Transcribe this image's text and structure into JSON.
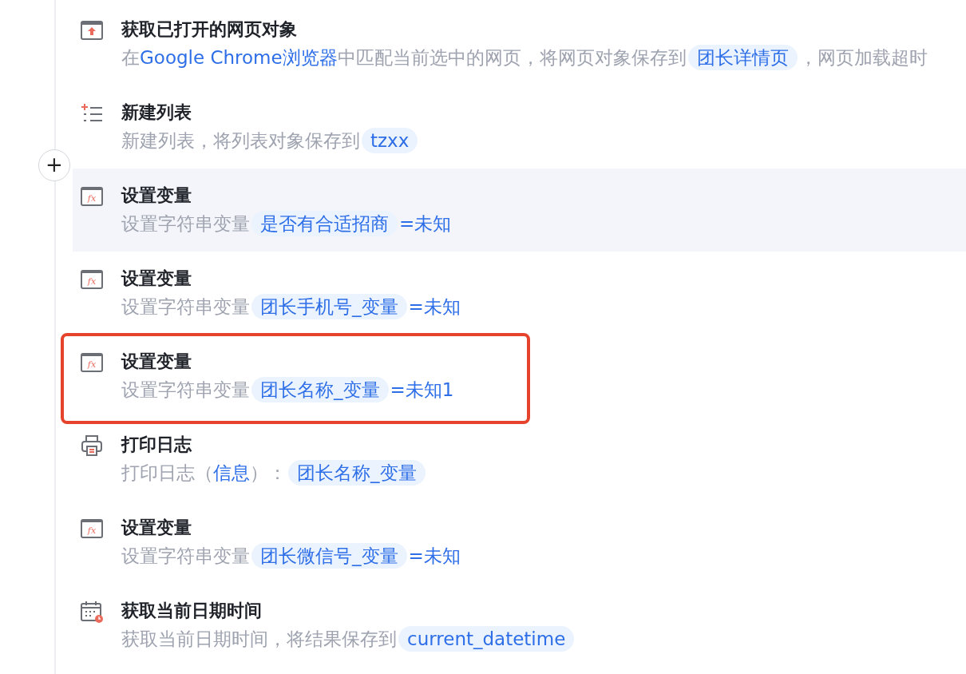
{
  "insert_button": {
    "symbol": "+"
  },
  "steps": [
    {
      "kind": "web",
      "title": "获取已打开的网页对象",
      "hovered": false,
      "outlined": false,
      "description": [
        {
          "kind": "text",
          "text": "在"
        },
        {
          "kind": "link",
          "text": "Google Chrome浏览器"
        },
        {
          "kind": "text",
          "text": "中匹配当前选中的网页，将网页对象保存到"
        },
        {
          "kind": "var",
          "text": "团长详情页"
        },
        {
          "kind": "text",
          "text": "，网页加载超时"
        }
      ]
    },
    {
      "kind": "list",
      "title": "新建列表",
      "hovered": false,
      "outlined": false,
      "description": [
        {
          "kind": "text",
          "text": "新建列表，将列表对象保存到"
        },
        {
          "kind": "var",
          "text": "tzxx"
        }
      ]
    },
    {
      "kind": "variable",
      "icon_label": "fx",
      "title": "设置变量",
      "hovered": true,
      "outlined": false,
      "description": [
        {
          "kind": "text",
          "text": "设置字符串变量"
        },
        {
          "kind": "var",
          "text": "是否有合适招商"
        },
        {
          "kind": "link",
          "text": "=未知"
        }
      ]
    },
    {
      "kind": "variable",
      "icon_label": "fx",
      "title": "设置变量",
      "hovered": false,
      "outlined": false,
      "description": [
        {
          "kind": "text",
          "text": "设置字符串变量"
        },
        {
          "kind": "var",
          "text": "团长手机号_变量"
        },
        {
          "kind": "link",
          "text": "=未知"
        }
      ]
    },
    {
      "kind": "variable",
      "icon_label": "fx",
      "title": "设置变量",
      "hovered": false,
      "outlined": true,
      "description": [
        {
          "kind": "text",
          "text": "设置字符串变量"
        },
        {
          "kind": "var",
          "text": "团长名称_变量"
        },
        {
          "kind": "link",
          "text": "=未知1"
        }
      ]
    },
    {
      "kind": "print",
      "title": "打印日志",
      "hovered": false,
      "outlined": false,
      "description": [
        {
          "kind": "text",
          "text": "打印日志（"
        },
        {
          "kind": "link",
          "text": "信息"
        },
        {
          "kind": "text",
          "text": "）："
        },
        {
          "kind": "var",
          "text": "团长名称_变量"
        }
      ]
    },
    {
      "kind": "variable",
      "icon_label": "fx",
      "title": "设置变量",
      "hovered": false,
      "outlined": false,
      "description": [
        {
          "kind": "text",
          "text": "设置字符串变量"
        },
        {
          "kind": "var",
          "text": "团长微信号_变量"
        },
        {
          "kind": "link",
          "text": "=未知"
        }
      ]
    },
    {
      "kind": "datetime",
      "title": "获取当前日期时间",
      "hovered": false,
      "outlined": false,
      "description": [
        {
          "kind": "text",
          "text": "获取当前日期时间，将结果保存到"
        },
        {
          "kind": "var",
          "text": "current_datetime"
        }
      ]
    }
  ]
}
